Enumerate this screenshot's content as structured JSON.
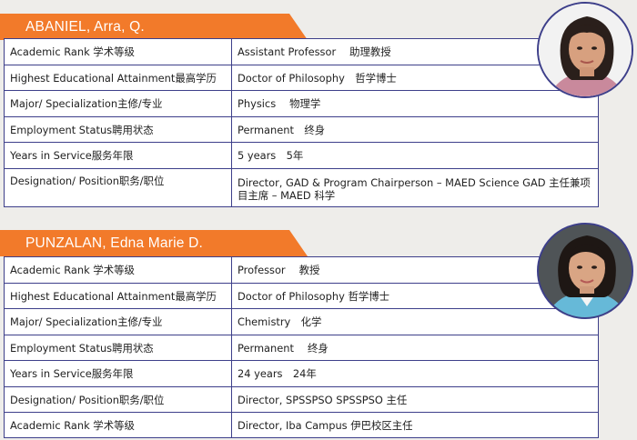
{
  "profiles": [
    {
      "name": "ABANIEL, Arra, Q.",
      "rows": [
        {
          "label": "Academic Rank 学术等级",
          "value": "Assistant Professor　 助理教授"
        },
        {
          "label": "Highest Educational Attainment最高学历",
          "value": "Doctor of Philosophy　哲学博士"
        },
        {
          "label": "Major/ Specialization主修/专业",
          "value": "Physics　 物理学"
        },
        {
          "label": "Employment Status聘用状态",
          "value": "Permanent　终身"
        },
        {
          "label": "Years in Service服务年限",
          "value": "5 years　5年"
        },
        {
          "label": "Designation/ Position职务/职位",
          "value": "Director, GAD & Program Chairperson – MAED Science  GAD 主任兼项目主席 – MAED 科学"
        }
      ]
    },
    {
      "name": "PUNZALAN, Edna Marie D.",
      "rows": [
        {
          "label": "Academic Rank 学术等级",
          "value": "Professor　 教授"
        },
        {
          "label": "Highest Educational Attainment最高学历",
          "value": "Doctor of Philosophy 哲学博士"
        },
        {
          "label": "Major/ Specialization主修/专业",
          "value": "Chemistry　化学"
        },
        {
          "label": "Employment Status聘用状态",
          "value": "Permanent　 终身"
        },
        {
          "label": "Years in Service服务年限",
          "value": "24 years　24年"
        },
        {
          "label": "Designation/ Position职务/职位",
          "value": "Director, SPSSPSO SPSSPSO 主任"
        },
        {
          "label": "Academic Rank 学术等级",
          "value": "Director, Iba Campus  伊巴校区主任"
        }
      ]
    }
  ]
}
